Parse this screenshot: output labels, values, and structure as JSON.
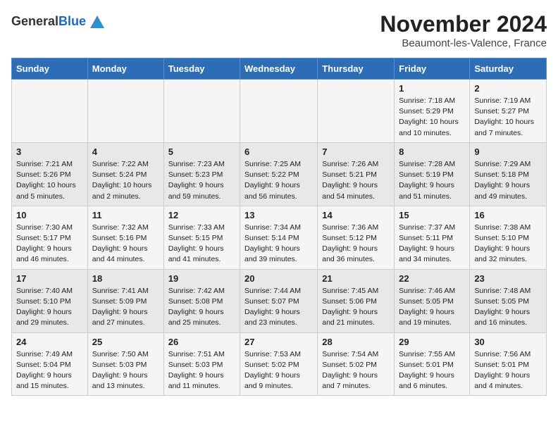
{
  "header": {
    "logo_general": "General",
    "logo_blue": "Blue",
    "month_year": "November 2024",
    "location": "Beaumont-les-Valence, France"
  },
  "weekdays": [
    "Sunday",
    "Monday",
    "Tuesday",
    "Wednesday",
    "Thursday",
    "Friday",
    "Saturday"
  ],
  "weeks": [
    [
      {
        "day": "",
        "info": ""
      },
      {
        "day": "",
        "info": ""
      },
      {
        "day": "",
        "info": ""
      },
      {
        "day": "",
        "info": ""
      },
      {
        "day": "",
        "info": ""
      },
      {
        "day": "1",
        "info": "Sunrise: 7:18 AM\nSunset: 5:29 PM\nDaylight: 10 hours and 10 minutes."
      },
      {
        "day": "2",
        "info": "Sunrise: 7:19 AM\nSunset: 5:27 PM\nDaylight: 10 hours and 7 minutes."
      }
    ],
    [
      {
        "day": "3",
        "info": "Sunrise: 7:21 AM\nSunset: 5:26 PM\nDaylight: 10 hours and 5 minutes."
      },
      {
        "day": "4",
        "info": "Sunrise: 7:22 AM\nSunset: 5:24 PM\nDaylight: 10 hours and 2 minutes."
      },
      {
        "day": "5",
        "info": "Sunrise: 7:23 AM\nSunset: 5:23 PM\nDaylight: 9 hours and 59 minutes."
      },
      {
        "day": "6",
        "info": "Sunrise: 7:25 AM\nSunset: 5:22 PM\nDaylight: 9 hours and 56 minutes."
      },
      {
        "day": "7",
        "info": "Sunrise: 7:26 AM\nSunset: 5:21 PM\nDaylight: 9 hours and 54 minutes."
      },
      {
        "day": "8",
        "info": "Sunrise: 7:28 AM\nSunset: 5:19 PM\nDaylight: 9 hours and 51 minutes."
      },
      {
        "day": "9",
        "info": "Sunrise: 7:29 AM\nSunset: 5:18 PM\nDaylight: 9 hours and 49 minutes."
      }
    ],
    [
      {
        "day": "10",
        "info": "Sunrise: 7:30 AM\nSunset: 5:17 PM\nDaylight: 9 hours and 46 minutes."
      },
      {
        "day": "11",
        "info": "Sunrise: 7:32 AM\nSunset: 5:16 PM\nDaylight: 9 hours and 44 minutes."
      },
      {
        "day": "12",
        "info": "Sunrise: 7:33 AM\nSunset: 5:15 PM\nDaylight: 9 hours and 41 minutes."
      },
      {
        "day": "13",
        "info": "Sunrise: 7:34 AM\nSunset: 5:14 PM\nDaylight: 9 hours and 39 minutes."
      },
      {
        "day": "14",
        "info": "Sunrise: 7:36 AM\nSunset: 5:12 PM\nDaylight: 9 hours and 36 minutes."
      },
      {
        "day": "15",
        "info": "Sunrise: 7:37 AM\nSunset: 5:11 PM\nDaylight: 9 hours and 34 minutes."
      },
      {
        "day": "16",
        "info": "Sunrise: 7:38 AM\nSunset: 5:10 PM\nDaylight: 9 hours and 32 minutes."
      }
    ],
    [
      {
        "day": "17",
        "info": "Sunrise: 7:40 AM\nSunset: 5:10 PM\nDaylight: 9 hours and 29 minutes."
      },
      {
        "day": "18",
        "info": "Sunrise: 7:41 AM\nSunset: 5:09 PM\nDaylight: 9 hours and 27 minutes."
      },
      {
        "day": "19",
        "info": "Sunrise: 7:42 AM\nSunset: 5:08 PM\nDaylight: 9 hours and 25 minutes."
      },
      {
        "day": "20",
        "info": "Sunrise: 7:44 AM\nSunset: 5:07 PM\nDaylight: 9 hours and 23 minutes."
      },
      {
        "day": "21",
        "info": "Sunrise: 7:45 AM\nSunset: 5:06 PM\nDaylight: 9 hours and 21 minutes."
      },
      {
        "day": "22",
        "info": "Sunrise: 7:46 AM\nSunset: 5:05 PM\nDaylight: 9 hours and 19 minutes."
      },
      {
        "day": "23",
        "info": "Sunrise: 7:48 AM\nSunset: 5:05 PM\nDaylight: 9 hours and 16 minutes."
      }
    ],
    [
      {
        "day": "24",
        "info": "Sunrise: 7:49 AM\nSunset: 5:04 PM\nDaylight: 9 hours and 15 minutes."
      },
      {
        "day": "25",
        "info": "Sunrise: 7:50 AM\nSunset: 5:03 PM\nDaylight: 9 hours and 13 minutes."
      },
      {
        "day": "26",
        "info": "Sunrise: 7:51 AM\nSunset: 5:03 PM\nDaylight: 9 hours and 11 minutes."
      },
      {
        "day": "27",
        "info": "Sunrise: 7:53 AM\nSunset: 5:02 PM\nDaylight: 9 hours and 9 minutes."
      },
      {
        "day": "28",
        "info": "Sunrise: 7:54 AM\nSunset: 5:02 PM\nDaylight: 9 hours and 7 minutes."
      },
      {
        "day": "29",
        "info": "Sunrise: 7:55 AM\nSunset: 5:01 PM\nDaylight: 9 hours and 6 minutes."
      },
      {
        "day": "30",
        "info": "Sunrise: 7:56 AM\nSunset: 5:01 PM\nDaylight: 9 hours and 4 minutes."
      }
    ]
  ]
}
